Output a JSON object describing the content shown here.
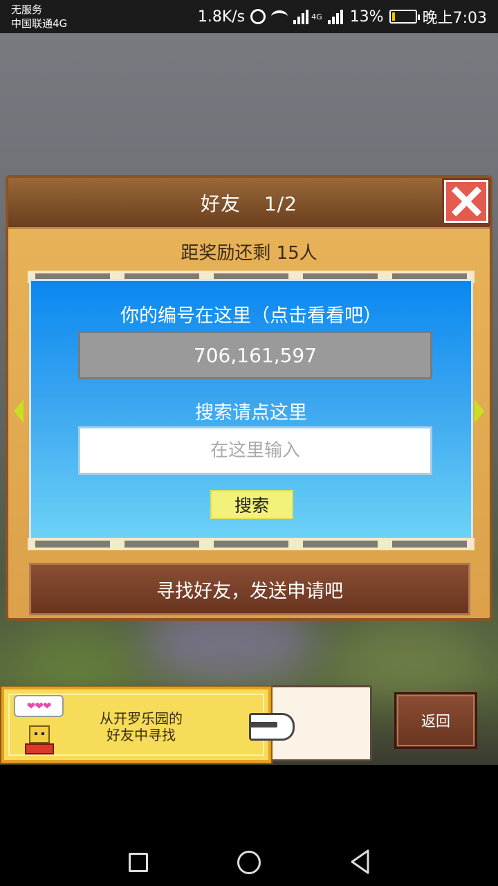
{
  "status_bar": {
    "carrier_line1": "无服务",
    "carrier_line2": "中国联通4G",
    "net_speed": "1.8K/s",
    "signal_label": "4G",
    "battery_percent": "13%",
    "battery_level": 0.13,
    "time": "晚上7:03"
  },
  "dialog": {
    "title": "好友",
    "page": "1/2",
    "reward_text": "距奖励还剩 15人",
    "id_caption": "你的编号在这里（点击看看吧）",
    "id_value": "706,161,597",
    "search_caption": "搜索请点这里",
    "search_placeholder": "在这里输入",
    "search_button": "搜索",
    "find_bar": "寻找好友，发送申请吧"
  },
  "banner": {
    "hearts": "❤❤❤",
    "line1": "从开罗乐园的",
    "line2": "好友中寻找"
  },
  "back_button": "返回",
  "colors": {
    "panel_blue": "#1a90f0",
    "wood": "#dca14a",
    "close_red": "#e45a4e",
    "search_yellow": "#f2f27a"
  }
}
